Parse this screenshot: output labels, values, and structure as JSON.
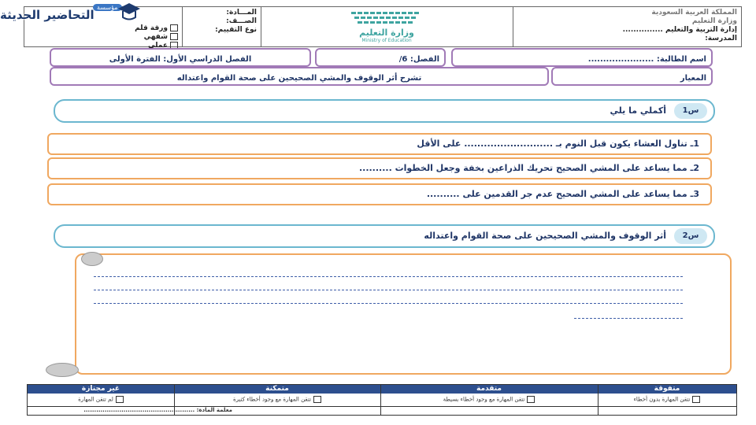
{
  "brand": {
    "name": "التحاضير الحديثة",
    "tag": "مؤسسة"
  },
  "header": {
    "subject_label": "المـــادة:",
    "grade_label": "الصـــف:",
    "assessment_type_label": "نوع التقييم:",
    "ministry_name": "وزارة التعليم",
    "ministry_en": "Ministry of Education",
    "kingdom": "المملكة العربية السعودية",
    "ministry_line": "وزارة التعليم",
    "admin_line": "إدارة التربية والتعليم ...............",
    "school_line": "المدرسة:",
    "options": [
      "ورقة قلم",
      "شفهي",
      "عملي"
    ]
  },
  "info": {
    "term": "الفصل الدراسي الأول: الفترة الأولى",
    "class": "الفصل: 6/",
    "student": "اسم الطالبة: ......................",
    "criterion_label": "المعيار",
    "criterion_value": "تشرح أثر الوقوف والمشي الصحيحين على صحة القوام واعتداله"
  },
  "q1": {
    "tag": "س1",
    "title": "أكملي ما يلي",
    "items": [
      "1ـ تناول العشاء يكون قبل النوم بـ ........................... على الأقل",
      "2ـ مما يساعد على المشي الصحيح تحريك الذراعين بخفة وجعل الخطوات ..........",
      "3ـ مما يساعد على المشي الصحيح عدم جر القدمين على .........."
    ]
  },
  "q2": {
    "tag": "س2",
    "title": "أثر الوقوف والمشي الصحيحين على صحة القوام واعتداله"
  },
  "rubric": {
    "headers": [
      "متفوقة",
      "متقدمة",
      "متمكنة",
      "غير مجتازة"
    ],
    "cells": [
      "تتقن المهارة بدون أخطاء",
      "تتقن المهارة مع وجود أخطاء بسيطة",
      "تتقن المهارة مع وجود أخطاء كثيرة",
      "لم تتقن المهارة"
    ],
    "teacher": "معلمة المادة: ....................................................."
  }
}
